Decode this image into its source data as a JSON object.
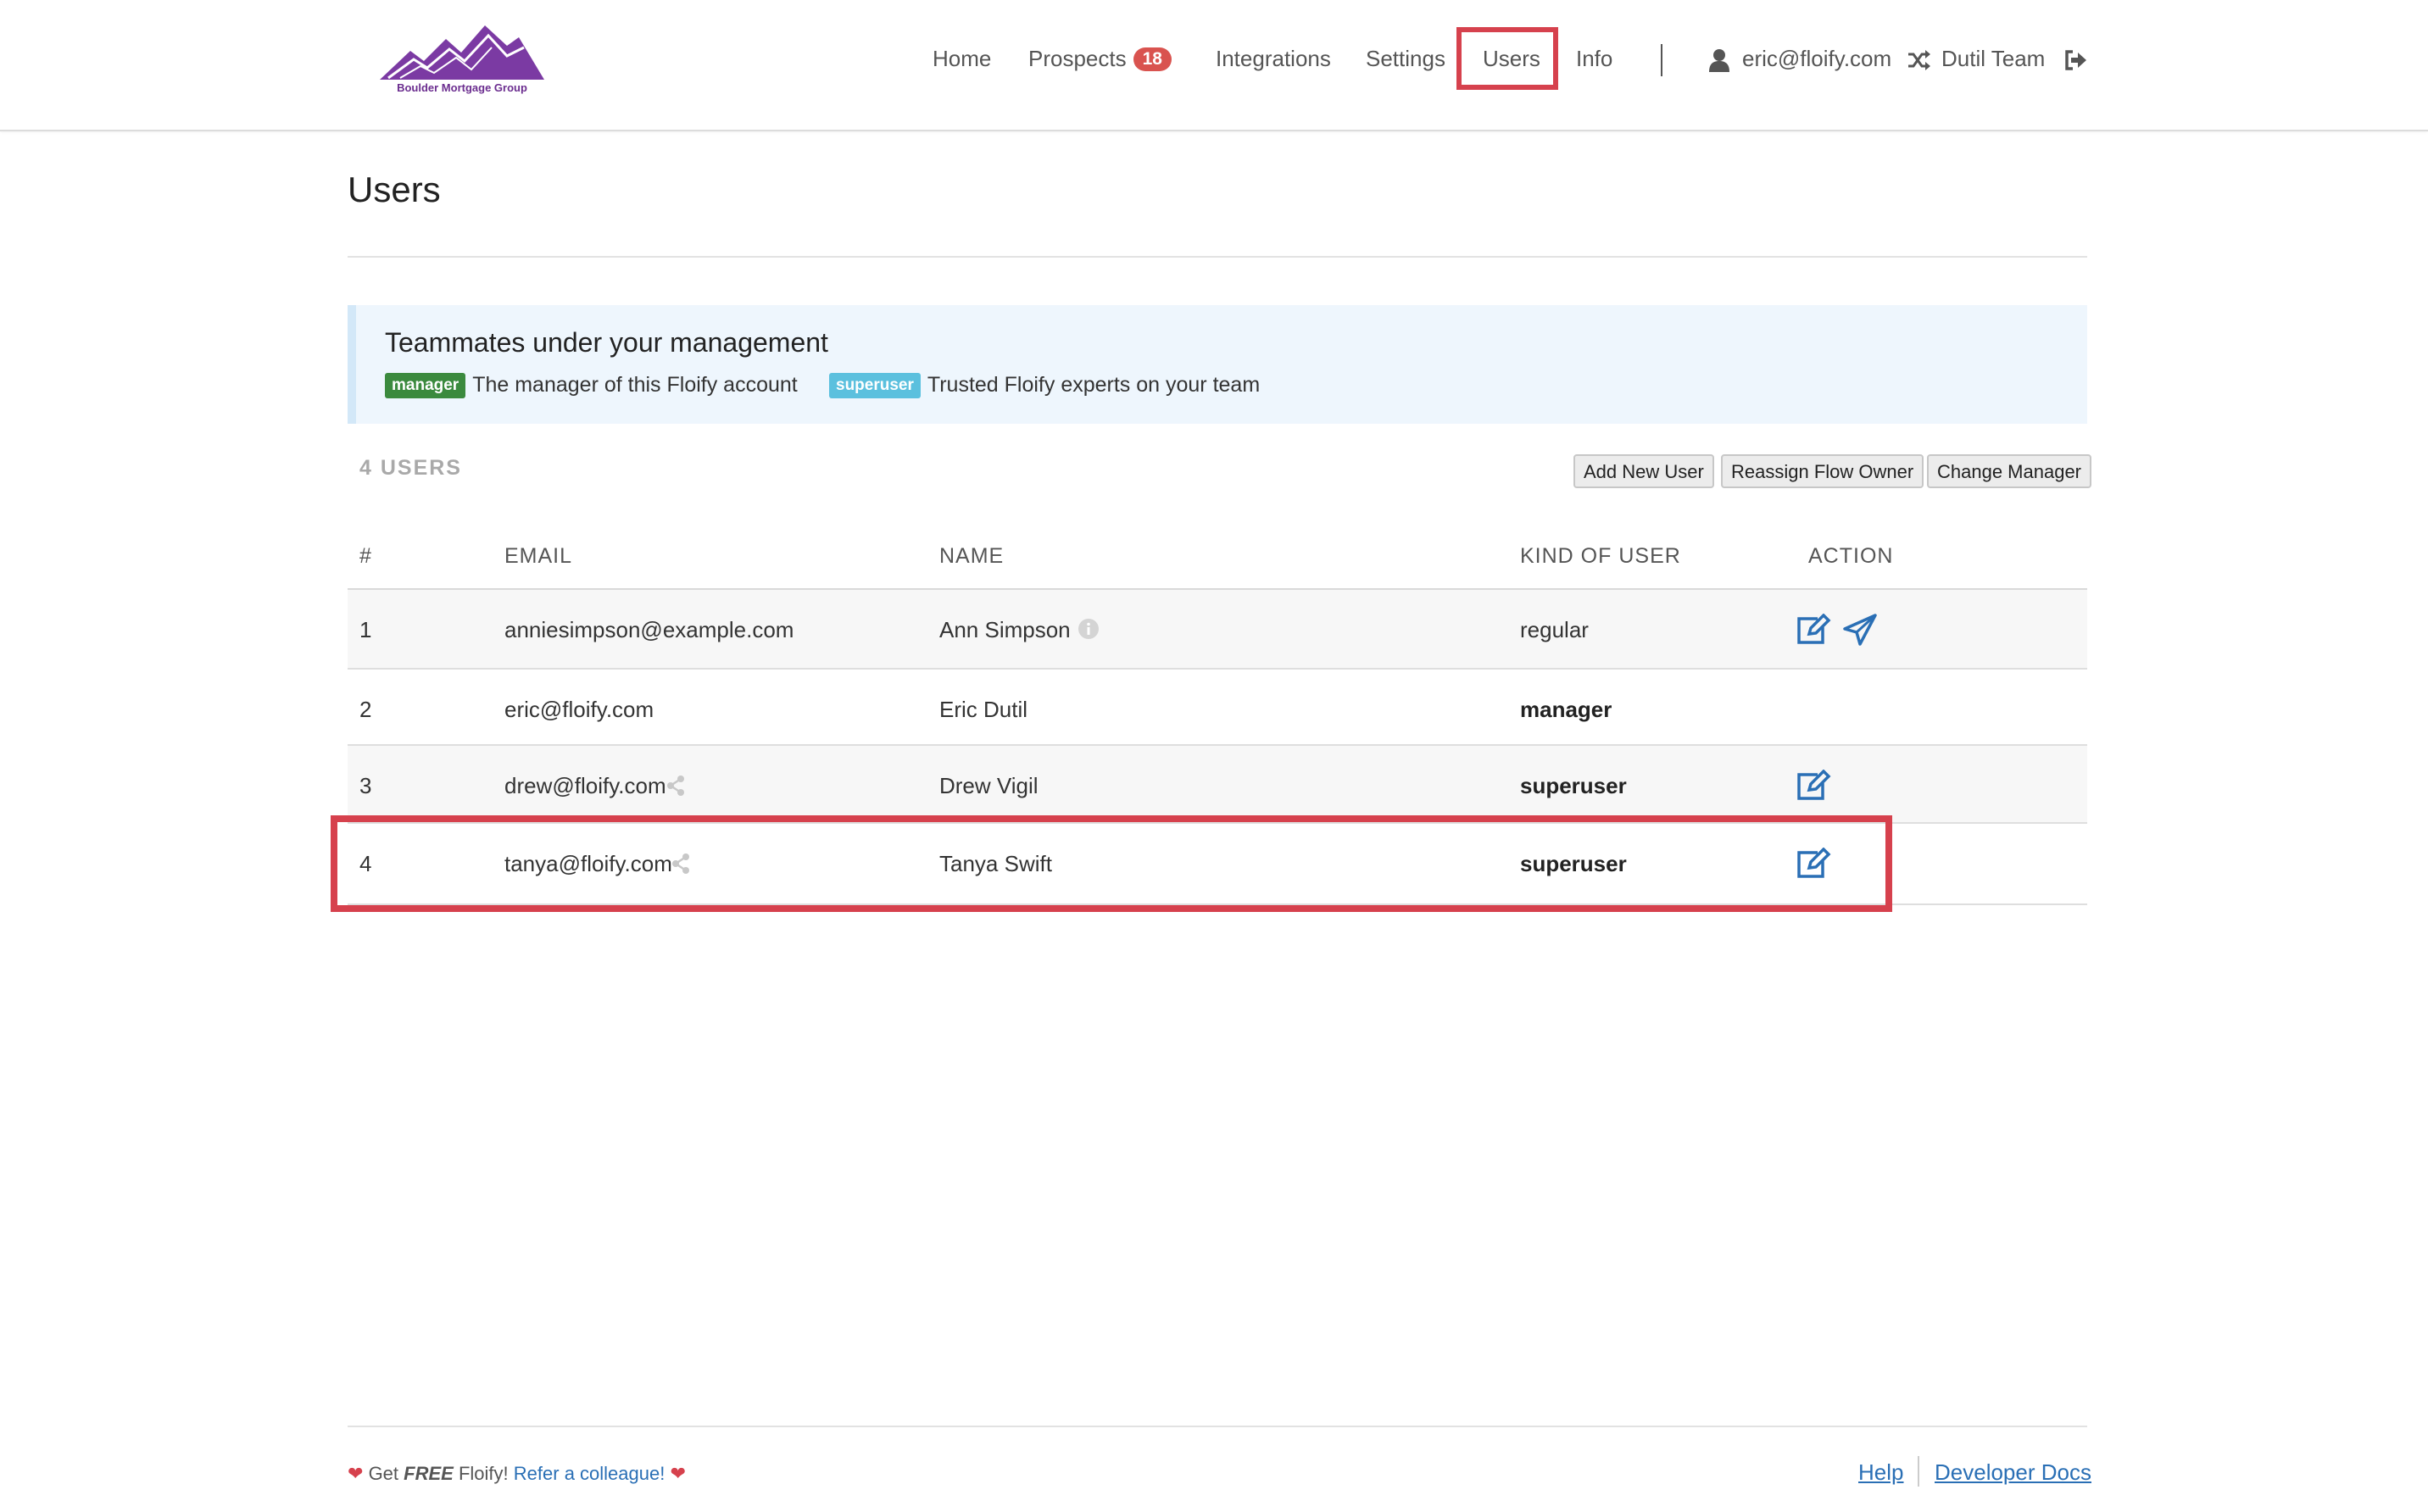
{
  "brand": {
    "name": "Boulder Mortgage Group",
    "logo_color": "#7b3aa3"
  },
  "nav": {
    "home": "Home",
    "prospects": "Prospects",
    "prospects_count": "18",
    "integrations": "Integrations",
    "settings": "Settings",
    "users": "Users",
    "info": "Info",
    "user_email": "eric@floify.com",
    "team": "Dutil Team",
    "icons": [
      "user-icon",
      "shuffle-icon",
      "sign-out-icon"
    ]
  },
  "page": {
    "title": "Users"
  },
  "callout": {
    "title": "Teammates under your management",
    "manager_tag": "manager",
    "manager_desc": "The manager of this Floify account",
    "superuser_tag": "superuser",
    "superuser_desc": "Trusted Floify experts on your team"
  },
  "toolbar": {
    "count_label": "4 USERS",
    "add_user": "Add New User",
    "reassign": "Reassign Flow Owner",
    "change_manager": "Change Manager"
  },
  "table": {
    "headers": [
      "#",
      "EMAIL",
      "NAME",
      "KIND OF USER",
      "ACTION"
    ],
    "rows": [
      {
        "num": "1",
        "email": "anniesimpson@example.com",
        "name": "Ann Simpson",
        "kind": "regular",
        "actions": [
          "edit-icon",
          "paper-plane-icon"
        ]
      },
      {
        "num": "2",
        "email": "eric@floify.com",
        "name": "Eric Dutil",
        "kind": "manager",
        "actions": []
      },
      {
        "num": "3",
        "email": "drew@floify.com",
        "name": "Drew Vigil",
        "kind": "superuser",
        "actions": [
          "edit-icon"
        ]
      },
      {
        "num": "4",
        "email": "tanya@floify.com",
        "name": "Tanya Swift",
        "kind": "superuser",
        "actions": [
          "edit-icon"
        ]
      }
    ]
  },
  "footer": {
    "get": "Get",
    "free": "FREE",
    "floify": "Floify!",
    "refer": "Refer a colleague!",
    "help": "Help",
    "dev_docs": "Developer Docs"
  },
  "colors": {
    "highlight": "#d6414d",
    "link": "#2a6fb5",
    "manager_tag": "#3b8a3e",
    "superuser_tag": "#5bc0de",
    "badge": "#d9534f"
  }
}
